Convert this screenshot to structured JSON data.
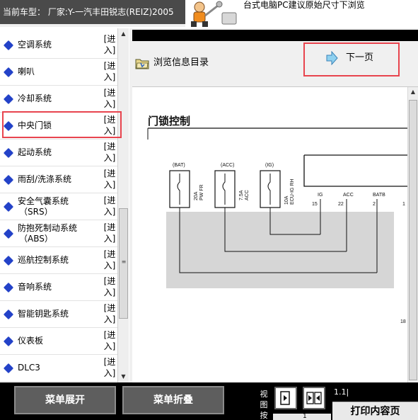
{
  "header": {
    "vehicle_text": "当前车型：  厂家:Y-一汽丰田锐志(REIZ)2005",
    "hint_text": "台式电脑PC建议原始尺寸下浏览"
  },
  "menu": {
    "enter_label": "[进入]",
    "items": [
      {
        "label": "空调系统"
      },
      {
        "label": "喇叭"
      },
      {
        "label": "冷却系统"
      },
      {
        "label": "中央门锁"
      },
      {
        "label": "起动系统"
      },
      {
        "label": "雨刮/洗涤系统"
      },
      {
        "label": "安全气囊系统",
        "sub": "（SRS）"
      },
      {
        "label": "防抱死制动系统",
        "sub": "（ABS）"
      },
      {
        "label": "巡航控制系统"
      },
      {
        "label": "音响系统"
      },
      {
        "label": "智能钥匙系统"
      },
      {
        "label": "仪表板"
      },
      {
        "label": "DLC3"
      }
    ],
    "selected_index": 3
  },
  "content": {
    "browse_label": "浏览信息目录",
    "next_page_label": "下一页"
  },
  "document": {
    "title": "门锁控制",
    "fuses": [
      {
        "id": "bat",
        "source": "(BAT)",
        "rating": "20A",
        "name": "PW FR"
      },
      {
        "id": "acc",
        "source": "(ACC)",
        "rating": "7.5A",
        "name": "ACC"
      },
      {
        "id": "ig",
        "source": "(IG)",
        "rating": "10A",
        "name": "ECU-IG RH"
      }
    ],
    "ecu_pins": [
      {
        "name": "IG",
        "number": "15"
      },
      {
        "name": "ACC",
        "number": "22"
      },
      {
        "name": "BATB",
        "number": "2"
      }
    ],
    "edge_number": "1",
    "page_side_number": "18"
  },
  "footer": {
    "expand_label": "菜单展开",
    "collapse_label": "菜单折叠",
    "view_label": "视图按",
    "zoom_value": "1.1|",
    "print_label": "打印内容页",
    "page_number": "1"
  },
  "colors": {
    "highlight": "#e8444e",
    "menu_bullet": "#2342c8"
  }
}
